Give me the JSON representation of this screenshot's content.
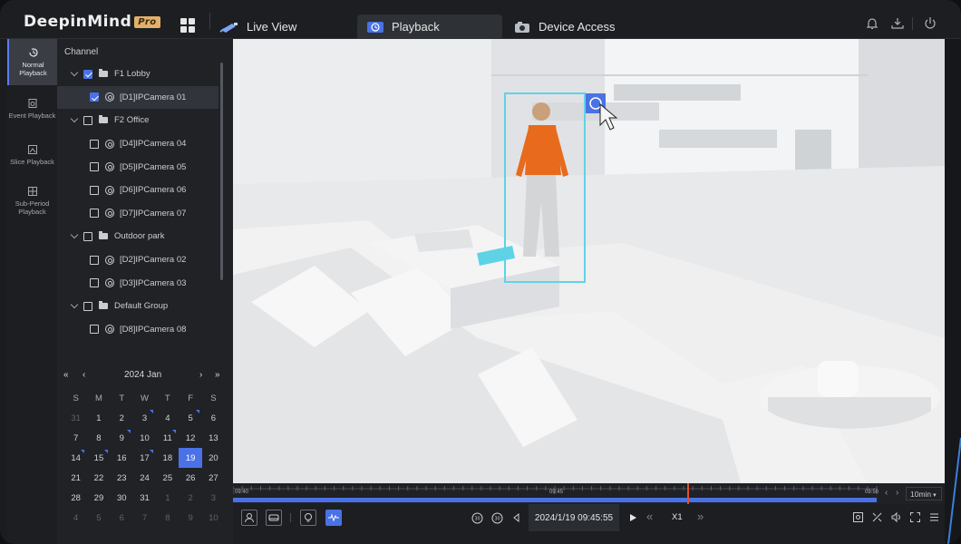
{
  "app": {
    "name": "DeepinMind",
    "edition": "Pro"
  },
  "tabs": [
    {
      "label": "Live View",
      "icon": "camera-icon"
    },
    {
      "label": "Playback",
      "icon": "playback-icon"
    },
    {
      "label": "Device Access",
      "icon": "device-icon"
    }
  ],
  "nav": [
    {
      "label": "Normal Playback",
      "icon": "history-icon"
    },
    {
      "label": "Event Playback",
      "icon": "event-icon"
    },
    {
      "label": "Slice Playback",
      "icon": "slice-icon"
    },
    {
      "label": "Sub-Period Playback",
      "icon": "grid-icon"
    }
  ],
  "channel": {
    "title": "Channel",
    "groups": [
      {
        "name": "F1 Lobby",
        "checked": true,
        "cameras": [
          {
            "name": "[D1]IPCamera 01",
            "checked": true
          }
        ]
      },
      {
        "name": "F2 Office",
        "checked": false,
        "cameras": [
          {
            "name": "[D4]IPCamera 04"
          },
          {
            "name": "[D5]IPCamera 05"
          },
          {
            "name": "[D6]IPCamera 06"
          },
          {
            "name": "[D7]IPCamera 07"
          }
        ]
      },
      {
        "name": "Outdoor park",
        "checked": false,
        "cameras": [
          {
            "name": "[D2]IPCamera 02"
          },
          {
            "name": "[D3]IPCamera 03"
          }
        ]
      },
      {
        "name": "Default Group",
        "checked": false,
        "cameras": [
          {
            "name": "[D8]IPCamera 08"
          }
        ]
      }
    ]
  },
  "calendar": {
    "month_label": "2024 Jan",
    "weekdays": [
      "S",
      "M",
      "T",
      "W",
      "T",
      "F",
      "S"
    ],
    "days": [
      {
        "d": "31",
        "dim": true
      },
      {
        "d": "1"
      },
      {
        "d": "2"
      },
      {
        "d": "3",
        "rec": true
      },
      {
        "d": "4"
      },
      {
        "d": "5",
        "rec": true
      },
      {
        "d": "6"
      },
      {
        "d": "7"
      },
      {
        "d": "8"
      },
      {
        "d": "9",
        "rec": true
      },
      {
        "d": "10"
      },
      {
        "d": "11",
        "rec": true
      },
      {
        "d": "12"
      },
      {
        "d": "13"
      },
      {
        "d": "14",
        "rec": true
      },
      {
        "d": "15",
        "rec": true
      },
      {
        "d": "16"
      },
      {
        "d": "17",
        "rec": true
      },
      {
        "d": "18"
      },
      {
        "d": "19",
        "cur": true
      },
      {
        "d": "20"
      },
      {
        "d": "21"
      },
      {
        "d": "22"
      },
      {
        "d": "23"
      },
      {
        "d": "24"
      },
      {
        "d": "25"
      },
      {
        "d": "26"
      },
      {
        "d": "27"
      },
      {
        "d": "28"
      },
      {
        "d": "29"
      },
      {
        "d": "30"
      },
      {
        "d": "31"
      },
      {
        "d": "1",
        "dim": true
      },
      {
        "d": "2",
        "dim": true
      },
      {
        "d": "3",
        "dim": true
      },
      {
        "d": "4",
        "dim": true
      },
      {
        "d": "5",
        "dim": true
      },
      {
        "d": "6",
        "dim": true
      },
      {
        "d": "7",
        "dim": true
      },
      {
        "d": "8",
        "dim": true
      },
      {
        "d": "9",
        "dim": true
      },
      {
        "d": "10",
        "dim": true
      }
    ]
  },
  "timeline": {
    "ticks": [
      "09:40",
      "09:45",
      "09:50"
    ],
    "zoom": "10min",
    "cursor_fraction": 0.59
  },
  "playback": {
    "datetime": "2024/1/19 09:45:55",
    "speed": "X1"
  },
  "colors": {
    "accent": "#4a72e6",
    "detection_box": "#5fd3e6",
    "playhead": "#e0502c"
  }
}
